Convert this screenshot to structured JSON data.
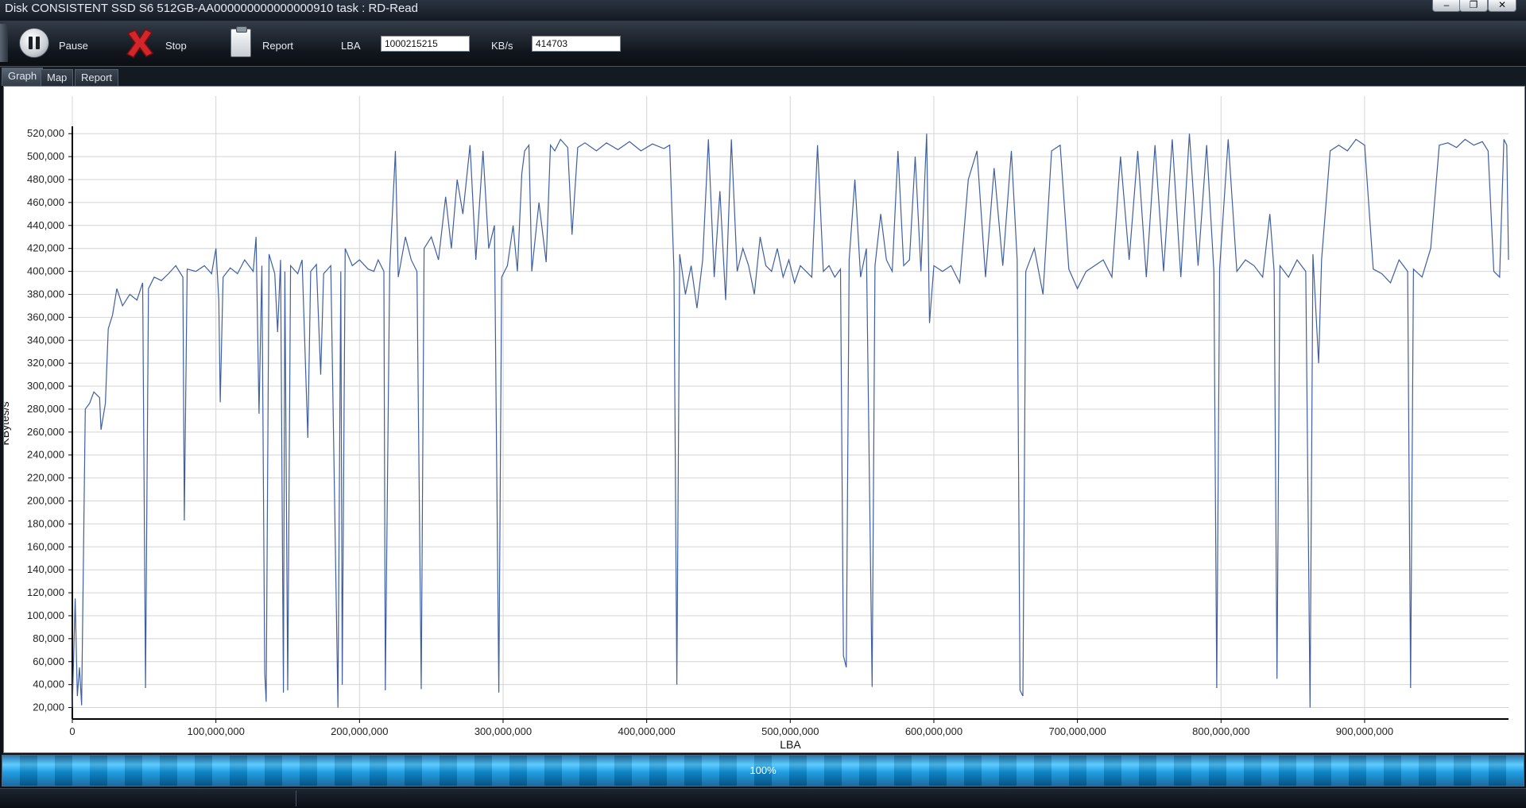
{
  "window": {
    "title": "Disk CONSISTENT SSD S6 512GB-AA000000000000000910   task : RD-Read",
    "controls": [
      "minimize-icon",
      "restore-icon",
      "close-icon"
    ]
  },
  "toolbar": {
    "pause_label": "Pause",
    "stop_label": "Stop",
    "report_label": "Report",
    "lba_label": "LBA",
    "lba_value": "1000215215",
    "kbs_label": "KB/s",
    "kbs_value": "414703"
  },
  "tabs": [
    {
      "label": "Graph",
      "active": true
    },
    {
      "label": "Map",
      "active": false
    },
    {
      "label": "Report",
      "active": false
    }
  ],
  "progress": {
    "text": "100%",
    "value": 1.0
  },
  "colors": {
    "line": "#3f5fa0",
    "grid": "#d4d4d4",
    "progress": "#2fb4f0"
  },
  "chart_data": {
    "type": "line",
    "title": "",
    "xlabel": "LBA",
    "ylabel": "KBytes/s",
    "xlim": [
      0,
      1000215215
    ],
    "ylim": [
      10000,
      525000
    ],
    "grid": true,
    "legend": "none",
    "x_ticks": [
      0,
      100000000,
      200000000,
      300000000,
      400000000,
      500000000,
      600000000,
      700000000,
      800000000,
      900000000
    ],
    "x_tick_labels": [
      "0",
      "100,000,000",
      "200,000,000",
      "300,000,000",
      "400,000,000",
      "500,000,000",
      "600,000,000",
      "700,000,000",
      "800,000,000",
      "900,000,000"
    ],
    "y_ticks": [
      20000,
      40000,
      60000,
      80000,
      100000,
      120000,
      140000,
      160000,
      180000,
      200000,
      220000,
      240000,
      260000,
      280000,
      300000,
      320000,
      340000,
      360000,
      380000,
      400000,
      420000,
      440000,
      460000,
      480000,
      500000,
      520000
    ],
    "y_tick_labels": [
      "20,000",
      "40,000",
      "60,000",
      "80,000",
      "100,000",
      "120,000",
      "140,000",
      "160,000",
      "180,000",
      "200,000",
      "220,000",
      "240,000",
      "260,000",
      "280,000",
      "300,000",
      "320,000",
      "340,000",
      "360,000",
      "380,000",
      "400,000",
      "420,000",
      "440,000",
      "460,000",
      "480,000",
      "500,000",
      "520,000"
    ],
    "series": [
      {
        "points": [
          [
            0,
            20000
          ],
          [
            2000000,
            115000
          ],
          [
            3500000,
            30000
          ],
          [
            5000000,
            55000
          ],
          [
            6500000,
            22000
          ],
          [
            9000000,
            280000
          ],
          [
            12000000,
            285000
          ],
          [
            15000000,
            295000
          ],
          [
            19000000,
            290000
          ],
          [
            20000000,
            262000
          ],
          [
            23000000,
            285000
          ],
          [
            25000000,
            350000
          ],
          [
            28000000,
            362000
          ],
          [
            31000000,
            385000
          ],
          [
            35000000,
            370000
          ],
          [
            40000000,
            380000
          ],
          [
            45000000,
            375000
          ],
          [
            49000000,
            390000
          ],
          [
            51000000,
            37000
          ],
          [
            53000000,
            385000
          ],
          [
            57000000,
            395000
          ],
          [
            62000000,
            392000
          ],
          [
            67000000,
            398000
          ],
          [
            72000000,
            405000
          ],
          [
            77000000,
            395000
          ],
          [
            78000000,
            183000
          ],
          [
            80000000,
            402000
          ],
          [
            86000000,
            400000
          ],
          [
            92000000,
            405000
          ],
          [
            97000000,
            398000
          ],
          [
            100000000,
            420000
          ],
          [
            102000000,
            375000
          ],
          [
            103000000,
            286000
          ],
          [
            105000000,
            395000
          ],
          [
            110000000,
            403000
          ],
          [
            115000000,
            398000
          ],
          [
            120000000,
            410000
          ],
          [
            126000000,
            400000
          ],
          [
            128000000,
            430000
          ],
          [
            130000000,
            276000
          ],
          [
            132000000,
            405000
          ],
          [
            134000000,
            50000
          ],
          [
            135000000,
            25000
          ],
          [
            137000000,
            415000
          ],
          [
            141000000,
            398000
          ],
          [
            143000000,
            347000
          ],
          [
            145000000,
            410000
          ],
          [
            147000000,
            33000
          ],
          [
            148000000,
            400000
          ],
          [
            150000000,
            35000
          ],
          [
            152000000,
            405000
          ],
          [
            157000000,
            398000
          ],
          [
            160000000,
            410000
          ],
          [
            164000000,
            255000
          ],
          [
            166000000,
            400000
          ],
          [
            170000000,
            406000
          ],
          [
            173000000,
            310000
          ],
          [
            175000000,
            398000
          ],
          [
            180000000,
            405000
          ],
          [
            185000000,
            20000
          ],
          [
            187000000,
            400000
          ],
          [
            188000000,
            40000
          ],
          [
            190000000,
            420000
          ],
          [
            195000000,
            405000
          ],
          [
            200000000,
            410000
          ],
          [
            206000000,
            402000
          ],
          [
            210000000,
            400000
          ],
          [
            213000000,
            410000
          ],
          [
            217000000,
            400000
          ],
          [
            218000000,
            35000
          ],
          [
            221000000,
            402000
          ],
          [
            225000000,
            505000
          ],
          [
            227000000,
            395000
          ],
          [
            232000000,
            430000
          ],
          [
            236000000,
            410000
          ],
          [
            240000000,
            400000
          ],
          [
            243000000,
            36000
          ],
          [
            245000000,
            420000
          ],
          [
            250000000,
            430000
          ],
          [
            255000000,
            410000
          ],
          [
            260000000,
            465000
          ],
          [
            264000000,
            420000
          ],
          [
            268000000,
            480000
          ],
          [
            272000000,
            450000
          ],
          [
            277000000,
            510000
          ],
          [
            281000000,
            410000
          ],
          [
            286000000,
            505000
          ],
          [
            290000000,
            420000
          ],
          [
            294000000,
            440000
          ],
          [
            297000000,
            33000
          ],
          [
            299000000,
            395000
          ],
          [
            303000000,
            405000
          ],
          [
            307000000,
            440000
          ],
          [
            310000000,
            400000
          ],
          [
            313000000,
            485000
          ],
          [
            315000000,
            505000
          ],
          [
            318000000,
            510000
          ],
          [
            320000000,
            400000
          ],
          [
            325000000,
            460000
          ],
          [
            330000000,
            408000
          ],
          [
            333000000,
            510000
          ],
          [
            336000000,
            505000
          ],
          [
            340000000,
            515000
          ],
          [
            345000000,
            508000
          ],
          [
            348000000,
            432000
          ],
          [
            352000000,
            508000
          ],
          [
            357000000,
            512000
          ],
          [
            365000000,
            505000
          ],
          [
            372000000,
            512000
          ],
          [
            380000000,
            506000
          ],
          [
            388000000,
            513000
          ],
          [
            396000000,
            505000
          ],
          [
            404000000,
            511000
          ],
          [
            412000000,
            507000
          ],
          [
            416000000,
            510000
          ],
          [
            419000000,
            400000
          ],
          [
            421000000,
            40000
          ],
          [
            423000000,
            415000
          ],
          [
            427000000,
            380000
          ],
          [
            431000000,
            405000
          ],
          [
            435000000,
            368000
          ],
          [
            439000000,
            410000
          ],
          [
            443000000,
            515000
          ],
          [
            447000000,
            395000
          ],
          [
            451000000,
            470000
          ],
          [
            455000000,
            375000
          ],
          [
            459000000,
            515000
          ],
          [
            463000000,
            400000
          ],
          [
            467000000,
            420000
          ],
          [
            471000000,
            405000
          ],
          [
            475000000,
            380000
          ],
          [
            479000000,
            430000
          ],
          [
            483000000,
            405000
          ],
          [
            487000000,
            400000
          ],
          [
            491000000,
            420000
          ],
          [
            495000000,
            395000
          ],
          [
            499000000,
            410000
          ],
          [
            503000000,
            390000
          ],
          [
            507000000,
            405000
          ],
          [
            511000000,
            400000
          ],
          [
            515000000,
            395000
          ],
          [
            519000000,
            510000
          ],
          [
            523000000,
            400000
          ],
          [
            527000000,
            405000
          ],
          [
            531000000,
            395000
          ],
          [
            535000000,
            402000
          ],
          [
            537000000,
            65000
          ],
          [
            539000000,
            55000
          ],
          [
            541000000,
            410000
          ],
          [
            545000000,
            480000
          ],
          [
            549000000,
            395000
          ],
          [
            553000000,
            420000
          ],
          [
            557000000,
            38000
          ],
          [
            559000000,
            405000
          ],
          [
            563000000,
            450000
          ],
          [
            567000000,
            410000
          ],
          [
            571000000,
            400000
          ],
          [
            575000000,
            505000
          ],
          [
            579000000,
            405000
          ],
          [
            583000000,
            410000
          ],
          [
            587000000,
            500000
          ],
          [
            591000000,
            400000
          ],
          [
            595000000,
            520000
          ],
          [
            597000000,
            355000
          ],
          [
            600000000,
            405000
          ],
          [
            606000000,
            400000
          ],
          [
            612000000,
            405000
          ],
          [
            618000000,
            390000
          ],
          [
            624000000,
            480000
          ],
          [
            630000000,
            505000
          ],
          [
            636000000,
            395000
          ],
          [
            642000000,
            490000
          ],
          [
            648000000,
            405000
          ],
          [
            654000000,
            505000
          ],
          [
            658000000,
            410000
          ],
          [
            660000000,
            35000
          ],
          [
            662000000,
            30000
          ],
          [
            664000000,
            400000
          ],
          [
            670000000,
            420000
          ],
          [
            676000000,
            380000
          ],
          [
            682000000,
            505000
          ],
          [
            688000000,
            510000
          ],
          [
            694000000,
            402000
          ],
          [
            700000000,
            385000
          ],
          [
            706000000,
            400000
          ],
          [
            712000000,
            405000
          ],
          [
            718000000,
            410000
          ],
          [
            724000000,
            395000
          ],
          [
            730000000,
            500000
          ],
          [
            736000000,
            410000
          ],
          [
            742000000,
            505000
          ],
          [
            748000000,
            395000
          ],
          [
            754000000,
            510000
          ],
          [
            760000000,
            400000
          ],
          [
            766000000,
            515000
          ],
          [
            772000000,
            395000
          ],
          [
            778000000,
            520000
          ],
          [
            784000000,
            405000
          ],
          [
            790000000,
            510000
          ],
          [
            795000000,
            400000
          ],
          [
            797000000,
            37000
          ],
          [
            799000000,
            402000
          ],
          [
            805000000,
            515000
          ],
          [
            811000000,
            400000
          ],
          [
            817000000,
            410000
          ],
          [
            823000000,
            405000
          ],
          [
            829000000,
            395000
          ],
          [
            834000000,
            450000
          ],
          [
            837000000,
            400000
          ],
          [
            839000000,
            45000
          ],
          [
            841000000,
            405000
          ],
          [
            847000000,
            395000
          ],
          [
            853000000,
            410000
          ],
          [
            859000000,
            400000
          ],
          [
            862000000,
            20000
          ],
          [
            864000000,
            415000
          ],
          [
            868000000,
            320000
          ],
          [
            870000000,
            410000
          ],
          [
            876000000,
            505000
          ],
          [
            882000000,
            510000
          ],
          [
            888000000,
            505000
          ],
          [
            894000000,
            515000
          ],
          [
            900000000,
            510000
          ],
          [
            906000000,
            402000
          ],
          [
            912000000,
            398000
          ],
          [
            918000000,
            390000
          ],
          [
            924000000,
            410000
          ],
          [
            930000000,
            400000
          ],
          [
            932000000,
            37000
          ],
          [
            934000000,
            402000
          ],
          [
            940000000,
            395000
          ],
          [
            946000000,
            420000
          ],
          [
            952000000,
            510000
          ],
          [
            958000000,
            512000
          ],
          [
            964000000,
            508000
          ],
          [
            970000000,
            515000
          ],
          [
            976000000,
            510000
          ],
          [
            982000000,
            513000
          ],
          [
            986000000,
            505000
          ],
          [
            990000000,
            400000
          ],
          [
            994000000,
            395000
          ],
          [
            997000000,
            515000
          ],
          [
            999000000,
            510000
          ],
          [
            1000215215,
            410000
          ]
        ]
      }
    ]
  }
}
